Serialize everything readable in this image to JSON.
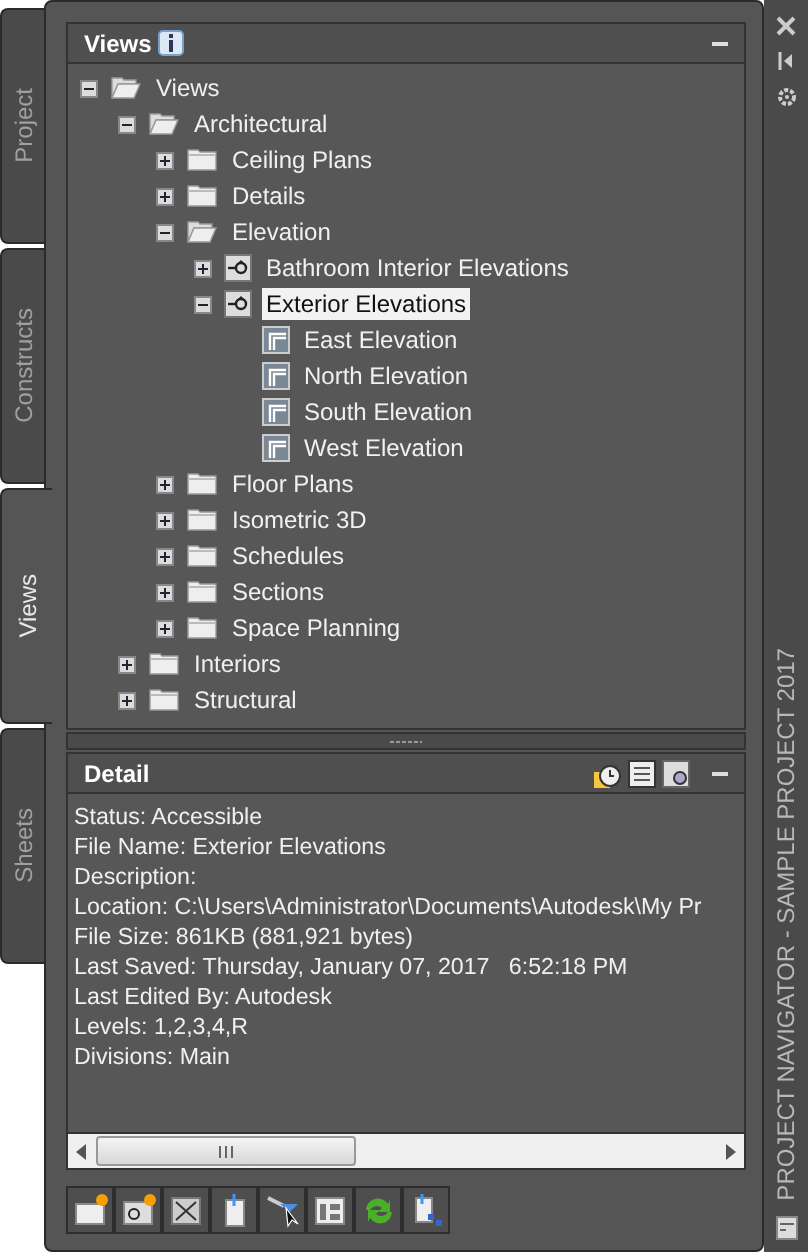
{
  "palette_title": "PROJECT NAVIGATOR - SAMPLE PROJECT 2017",
  "side_tabs": [
    {
      "label": "Project",
      "selected": false
    },
    {
      "label": "Constructs",
      "selected": false
    },
    {
      "label": "Views",
      "selected": true
    },
    {
      "label": "Sheets",
      "selected": false
    }
  ],
  "views_panel": {
    "title": "Views",
    "tree": [
      {
        "label": "Views",
        "kind": "folder",
        "expanded": true,
        "selected": false,
        "children": [
          {
            "label": "Architectural",
            "kind": "folder",
            "expanded": true,
            "selected": false,
            "children": [
              {
                "label": "Ceiling Plans",
                "kind": "folder",
                "expanded": false,
                "selected": false
              },
              {
                "label": "Details",
                "kind": "folder",
                "expanded": false,
                "selected": false
              },
              {
                "label": "Elevation",
                "kind": "folder",
                "expanded": true,
                "selected": false,
                "children": [
                  {
                    "label": "Bathroom Interior Elevations",
                    "kind": "elevation",
                    "expanded": false,
                    "selected": false
                  },
                  {
                    "label": "Exterior Elevations",
                    "kind": "elevation",
                    "expanded": true,
                    "selected": true,
                    "children": [
                      {
                        "label": "East Elevation",
                        "kind": "view",
                        "selected": false
                      },
                      {
                        "label": "North Elevation",
                        "kind": "view",
                        "selected": false
                      },
                      {
                        "label": "South Elevation",
                        "kind": "view",
                        "selected": false
                      },
                      {
                        "label": "West Elevation",
                        "kind": "view",
                        "selected": false
                      }
                    ]
                  }
                ]
              },
              {
                "label": "Floor Plans",
                "kind": "folder",
                "expanded": false,
                "selected": false
              },
              {
                "label": "Isometric 3D",
                "kind": "folder",
                "expanded": false,
                "selected": false
              },
              {
                "label": "Schedules",
                "kind": "folder",
                "expanded": false,
                "selected": false
              },
              {
                "label": "Sections",
                "kind": "folder",
                "expanded": false,
                "selected": false
              },
              {
                "label": "Space Planning",
                "kind": "folder",
                "expanded": false,
                "selected": false
              }
            ]
          },
          {
            "label": "Interiors",
            "kind": "folder",
            "expanded": false,
            "selected": false
          },
          {
            "label": "Structural",
            "kind": "folder",
            "expanded": false,
            "selected": false
          }
        ]
      }
    ]
  },
  "detail_panel": {
    "title": "Detail",
    "lines": [
      "Status: Accessible",
      "File Name: Exterior Elevations",
      "Description:",
      "Location: C:\\Users\\Administrator\\Documents\\Autodesk\\My Pr",
      "File Size: 861KB (881,921 bytes)",
      "Last Saved: Thursday, January 07, 2017   6:52:18 PM",
      "Last Edited By: Autodesk",
      "Levels: 1,2,3,4,R",
      "Divisions: Main"
    ]
  }
}
